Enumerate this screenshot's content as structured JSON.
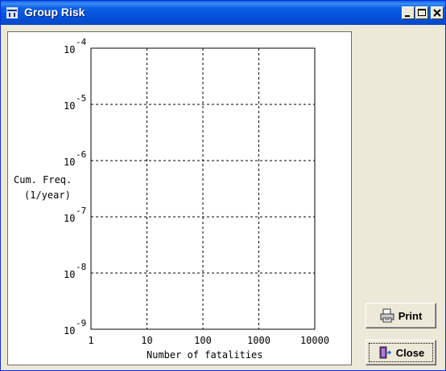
{
  "window": {
    "title": "Group Risk"
  },
  "buttons": {
    "print_label": "Print",
    "close_label": "Close"
  },
  "chart_data": {
    "type": "line",
    "title": "",
    "xlabel": "Number of fatalities",
    "ylabel_line1": "Cum. Freq.",
    "ylabel_line2": "(1/year)",
    "x_scale": "log",
    "y_scale": "log",
    "xlim": [
      1,
      10000
    ],
    "ylim": [
      1e-09,
      0.0001
    ],
    "x_ticks": [
      "1",
      "10",
      "100",
      "1000",
      "10000"
    ],
    "y_tick_base": "10",
    "y_tick_exponents": [
      "-4",
      "-5",
      "-6",
      "-7",
      "-8",
      "-9"
    ],
    "grid": true,
    "series": []
  }
}
